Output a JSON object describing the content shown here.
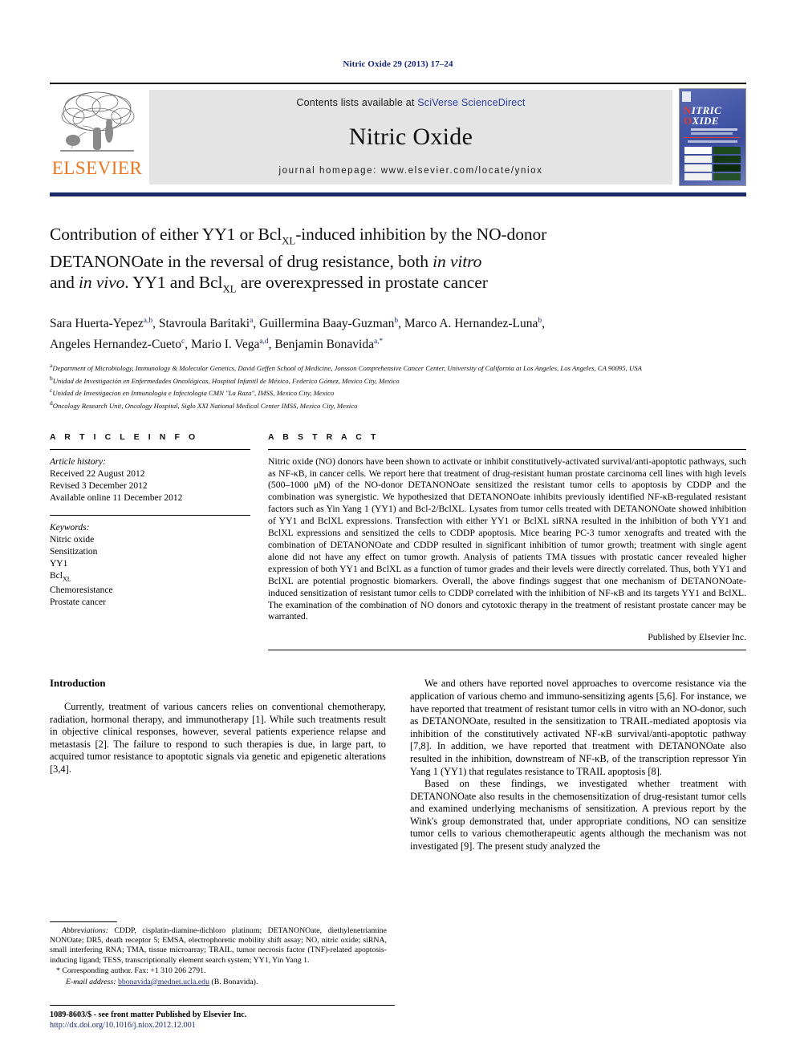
{
  "running_head": "Nitric Oxide 29 (2013) 17–24",
  "masthead": {
    "publisher_name": "ELSEVIER",
    "contents_prefix": "Contents lists available at ",
    "contents_link": "SciVerse ScienceDirect",
    "journal_title": "Nitric Oxide",
    "homepage": "journal homepage: www.elsevier.com/locate/yniox",
    "cover": {
      "line1": "NITRIC",
      "line2": "OXIDE",
      "cap1": "N",
      "cap2": "O",
      "rest1": "ITRIC",
      "rest2": "XIDE"
    }
  },
  "article": {
    "title_line1": "Contribution of either YY1 or Bcl",
    "title_sub1": "XL",
    "title_line1b": "-induced inhibition by the NO-donor",
    "title_line2": "DETANONOate in the reversal of drug resistance, both ",
    "title_line2_it": "in vitro",
    "title_line3a": "and ",
    "title_line3_it": "in vivo",
    "title_line3b": ". YY1 and Bcl",
    "title_sub2": "XL",
    "title_line3c": " are overexpressed in prostate cancer",
    "authors_line1": "Sara Huerta-Yepez",
    "authors_sup1": "a,b",
    "authors_line1b": ", Stavroula Baritaki",
    "authors_sup2": "a",
    "authors_line1c": ", Guillermina Baay-Guzman",
    "authors_sup3": "b",
    "authors_line1d": ", Marco A. Hernandez-Luna",
    "authors_sup4": "b",
    "authors_line1e": ",",
    "authors_line2": "Angeles Hernandez-Cueto",
    "authors_sup5": "c",
    "authors_line2b": ", Mario I. Vega",
    "authors_sup6": "a,d",
    "authors_line2c": ", Benjamin Bonavida",
    "authors_sup7": "a,*",
    "affiliations": [
      {
        "marker": "a",
        "text": "Department of Microbiology, Immunology & Molecular Genetics, David Geffen School of Medicine, Jonsson Comprehensive Cancer Center, University of California at Los Angeles, Los Angeles, CA 90095, USA"
      },
      {
        "marker": "b",
        "text": "Unidad de Investigación en Enfermedades Oncológicas, Hospital Infantil de México, Federico Gómez, Mexico City, Mexico"
      },
      {
        "marker": "c",
        "text": "Unidad de Investigacion en Inmunologia e Infectologia CMN \"La Raza\", IMSS, Mexico City, Mexico"
      },
      {
        "marker": "d",
        "text": "Oncology Research Unit, Oncology Hospital, Siglo XXI National Medical Center IMSS, Mexico City, Mexico"
      }
    ]
  },
  "article_info": {
    "heading": "A R T I C L E   I N F O",
    "history_label": "Article history:",
    "history": [
      "Received 22 August 2012",
      "Revised 3 December 2012",
      "Available online 11 December 2012"
    ],
    "keywords_label": "Keywords:",
    "keywords": [
      "Nitric oxide",
      "Sensitization",
      "YY1",
      "BclXL",
      "Chemoresistance",
      "Prostate cancer"
    ],
    "keyword_bcl_base": "Bcl",
    "keyword_bcl_sub": "XL"
  },
  "abstract": {
    "heading": "A B S T R A C T",
    "p1": "Nitric oxide (NO) donors have been shown to activate or inhibit constitutively-activated survival/anti-apoptotic pathways, such as NF-κB, in cancer cells. We report here that treatment of drug-resistant human prostate carcinoma cell lines with high levels (500–1000 μM) of the NO-donor DETANONOate sensitized the resistant tumor cells to apoptosis by CDDP and the combination was synergistic. We hypothesized that DETANONOate inhibits previously identified NF-κB-regulated resistant factors such as Yin Yang 1 (YY1) and Bcl-2/BclXL. Lysates from tumor cells treated with DETANONOate showed inhibition of YY1 and BclXL expressions. Transfection with either YY1 or BclXL siRNA resulted in the inhibition of both YY1 and BclXL expressions and sensitized the cells to CDDP apoptosis. Mice bearing PC-3 tumor xenografts and treated with the combination of DETANONOate and CDDP resulted in significant inhibition of tumor growth; treatment with single agent alone did not have any effect on tumor growth. Analysis of patients TMA tissues with prostatic cancer revealed higher expression of both YY1 and BclXL as a function of tumor grades and their levels were directly correlated. Thus, both YY1 and BclXL are potential prognostic biomarkers. Overall, the above findings suggest that one mechanism of DETANONOate-induced sensitization of resistant tumor cells to CDDP correlated with the inhibition of NF-κB and its targets YY1 and BclXL. The examination of the combination of NO donors and cytotoxic therapy in the treatment of resistant prostate cancer may be warranted.",
    "published_by": "Published by Elsevier Inc."
  },
  "introduction": {
    "heading": "Introduction",
    "p1": "Currently, treatment of various cancers relies on conventional chemotherapy, radiation, hormonal therapy, and immunotherapy [1]. While such treatments result in objective clinical responses, however, several patients experience relapse and metastasis [2]. The failure to respond to such therapies is due, in large part, to acquired tumor resistance to apoptotic signals via genetic and epigenetic alterations [3,4].",
    "p2": "We and others have reported novel approaches to overcome resistance via the application of various chemo and immuno-sensitizing agents [5,6]. For instance, we have reported that treatment of resistant tumor cells in vitro with an NO-donor, such as DETANONOate, resulted in the sensitization to TRAIL-mediated apoptosis via inhibition of the constitutively activated NF-κB survival/anti-apoptotic pathway [7,8]. In addition, we have reported that treatment with DETANONOate also resulted in the inhibition, downstream of NF-κB, of the transcription repressor Yin Yang 1 (YY1) that regulates resistance to TRAIL apoptosis [8].",
    "p3": "Based on these findings, we investigated whether treatment with DETANONOate also results in the chemosensitization of drug-resistant tumor cells and examined underlying mechanisms of sensitization. A previous report by the Wink's group demonstrated that, under appropriate conditions, NO can sensitize tumor cells to various chemotherapeutic agents although the mechanism was not investigated [9]. The present study analyzed the"
  },
  "footnotes": {
    "abbrev_label": "Abbreviations:",
    "abbrev_text": " CDDP, cisplatin-diamine-dichloro platinum; DETANONOate, diethylenetriamine NONOate; DR5, death receptor 5; EMSA, electrophoretic mobility shift assay; NO, nitric oxide; siRNA, small interfering RNA; TMA, tissue microarray; TRAIL, tumor necrosis factor (TNF)-related apoptosis-inducing ligand; TESS, transcriptionally element search system; YY1, Yin Yang 1.",
    "corresponding": "* Corresponding author. Fax: +1 310 206 2791.",
    "email_label": "E-mail address:",
    "email": "bbonavida@mednet.ucla.edu",
    "email_suffix": " (B. Bonavida)."
  },
  "page_footer": {
    "issn_line": "1089-8603/$ - see front matter Published by Elsevier Inc.",
    "doi_line": "http://dx.doi.org/10.1016/j.niox.2012.12.001"
  },
  "colors": {
    "link_blue": "#2b3f9e",
    "ref_blue": "#1b2a6b",
    "elsevier_orange": "#e87722",
    "masthead_grey": "#e4e4e4"
  }
}
